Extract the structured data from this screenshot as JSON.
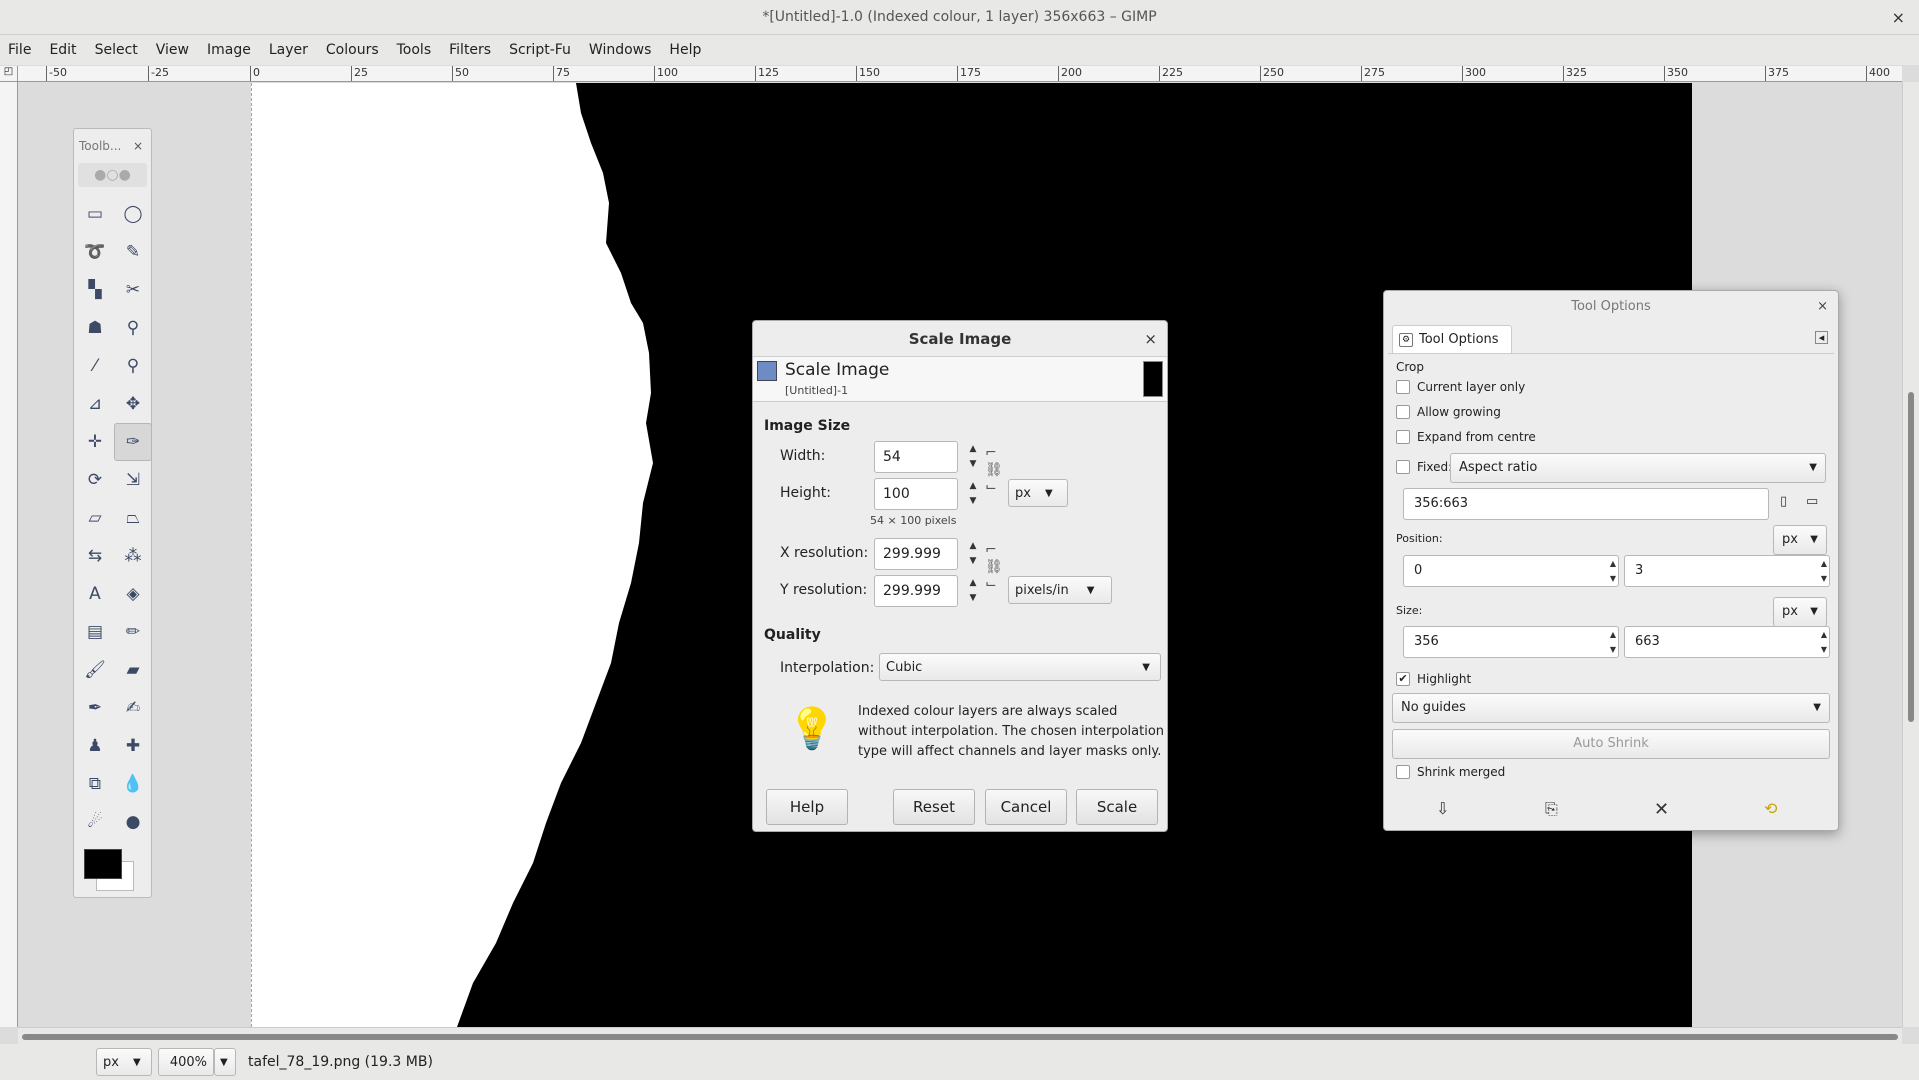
{
  "window": {
    "title": "*[Untitled]-1.0 (Indexed colour, 1 layer) 356x663 – GIMP",
    "close": "×"
  },
  "menu": [
    "File",
    "Edit",
    "Select",
    "View",
    "Image",
    "Layer",
    "Colours",
    "Tools",
    "Filters",
    "Script-Fu",
    "Windows",
    "Help"
  ],
  "ruler": {
    "ticks": [
      "-50",
      "-25",
      "0",
      "25",
      "50",
      "75",
      "100",
      "125",
      "150",
      "175",
      "200",
      "225",
      "250",
      "275",
      "300",
      "325",
      "350",
      "375",
      "400"
    ]
  },
  "statusbar": {
    "unit": "px",
    "zoom": "400%",
    "file": "tafel_78_19.png (19.3 MB)"
  },
  "toolbox": {
    "title": "Toolb...",
    "close": "×",
    "tools": [
      {
        "name": "rect-select-icon",
        "glyph": "▭"
      },
      {
        "name": "ellipse-select-icon",
        "glyph": "◯"
      },
      {
        "name": "free-select-icon",
        "glyph": "➰"
      },
      {
        "name": "fuzzy-select-icon",
        "glyph": "✎"
      },
      {
        "name": "select-by-color-icon",
        "glyph": "▚"
      },
      {
        "name": "scissors-icon",
        "glyph": "✂"
      },
      {
        "name": "foreground-select-icon",
        "glyph": "☗"
      },
      {
        "name": "paths-icon",
        "glyph": "⚲"
      },
      {
        "name": "color-picker-icon",
        "glyph": "⁄"
      },
      {
        "name": "zoom-icon",
        "glyph": "⚲"
      },
      {
        "name": "measure-icon",
        "glyph": "⊿"
      },
      {
        "name": "move-icon",
        "glyph": "✥"
      },
      {
        "name": "align-icon",
        "glyph": "✛"
      },
      {
        "name": "crop-icon",
        "glyph": "✑",
        "active": true
      },
      {
        "name": "unified-transform-icon",
        "glyph": "⟳"
      },
      {
        "name": "scale-icon",
        "glyph": "⇲"
      },
      {
        "name": "shear-icon",
        "glyph": "▱"
      },
      {
        "name": "perspective-icon",
        "glyph": "⏢"
      },
      {
        "name": "flip-icon",
        "glyph": "⇆"
      },
      {
        "name": "cage-icon",
        "glyph": "⁂"
      },
      {
        "name": "text-icon",
        "glyph": "A"
      },
      {
        "name": "bucket-fill-icon",
        "glyph": "◈"
      },
      {
        "name": "gradient-icon",
        "glyph": "▤"
      },
      {
        "name": "pencil-icon",
        "glyph": "✏"
      },
      {
        "name": "paintbrush-icon",
        "glyph": "🖌"
      },
      {
        "name": "eraser-icon",
        "glyph": "▰"
      },
      {
        "name": "airbrush-icon",
        "glyph": "✒"
      },
      {
        "name": "ink-icon",
        "glyph": "✍"
      },
      {
        "name": "clone-icon",
        "glyph": "♟"
      },
      {
        "name": "heal-icon",
        "glyph": "✚"
      },
      {
        "name": "perspective-clone-icon",
        "glyph": "⧉"
      },
      {
        "name": "blur-icon",
        "glyph": "💧"
      },
      {
        "name": "smudge-icon",
        "glyph": "☄"
      },
      {
        "name": "dodge-burn-icon",
        "glyph": "●"
      }
    ]
  },
  "scale_dialog": {
    "title": "Scale Image",
    "close": "×",
    "heading": "Scale Image",
    "subheading": "[Untitled]-1",
    "image_size_label": "Image Size",
    "width_label": "Width:",
    "width_value": "54",
    "height_label": "Height:",
    "height_value": "100",
    "unit": "px",
    "pixels_info": "54 × 100 pixels",
    "xres_label": "X resolution:",
    "xres_value": "299.999",
    "yres_label": "Y resolution:",
    "yres_value": "299.999",
    "res_unit": "pixels/in",
    "quality_label": "Quality",
    "interp_label": "Interpolation:",
    "interp_value": "Cubic",
    "tip_line1": "Indexed colour layers are always scaled",
    "tip_line2": "without interpolation. The chosen interpolation",
    "tip_line3": "type will affect channels and layer masks only.",
    "help": "Help",
    "reset": "Reset",
    "cancel": "Cancel",
    "scale": "Scale"
  },
  "tool_options": {
    "title": "Tool Options",
    "close": "×",
    "tab": "Tool Options",
    "section": "Crop",
    "current_layer_only": "Current layer only",
    "allow_growing": "Allow growing",
    "expand_from_centre": "Expand from centre",
    "fixed": "Fixed:",
    "fixed_mode": "Aspect ratio",
    "ratio": "356:663",
    "position_label": "Position:",
    "position_unit": "px",
    "pos_x": "0",
    "pos_y": "3",
    "size_label": "Size:",
    "size_unit": "px",
    "size_w": "356",
    "size_h": "663",
    "highlight": "Highlight",
    "guides": "No guides",
    "auto_shrink": "Auto Shrink",
    "shrink_merged": "Shrink merged"
  }
}
